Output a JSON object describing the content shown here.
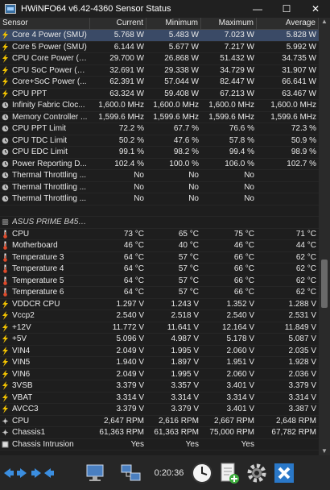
{
  "window": {
    "title": "HWiNFO64 v6.42-4360 Sensor Status",
    "minimize": "—",
    "maximize": "☐",
    "close": "✕"
  },
  "columns": [
    "Sensor",
    "Current",
    "Minimum",
    "Maximum",
    "Average"
  ],
  "rows": [
    {
      "icon": "bolt",
      "label": "Core 4 Power (SMU)",
      "cur": "5.768 W",
      "min": "5.483 W",
      "max": "7.023 W",
      "avg": "5.828 W",
      "selected": true
    },
    {
      "icon": "bolt",
      "label": "Core 5 Power (SMU)",
      "cur": "6.144 W",
      "min": "5.677 W",
      "max": "7.217 W",
      "avg": "5.992 W"
    },
    {
      "icon": "bolt",
      "label": "CPU Core Power (S...",
      "cur": "29.700 W",
      "min": "26.868 W",
      "max": "51.432 W",
      "avg": "34.735 W"
    },
    {
      "icon": "bolt",
      "label": "CPU SoC Power (S...",
      "cur": "32.691 W",
      "min": "29.338 W",
      "max": "34.729 W",
      "avg": "31.907 W"
    },
    {
      "icon": "bolt",
      "label": "Core+SoC Power (...",
      "cur": "62.391 W",
      "min": "57.044 W",
      "max": "82.447 W",
      "avg": "66.641 W"
    },
    {
      "icon": "bolt",
      "label": "CPU PPT",
      "cur": "63.324 W",
      "min": "59.408 W",
      "max": "67.213 W",
      "avg": "63.467 W"
    },
    {
      "icon": "clock",
      "label": "Infinity Fabric Cloc...",
      "cur": "1,600.0 MHz",
      "min": "1,600.0 MHz",
      "max": "1,600.0 MHz",
      "avg": "1,600.0 MHz"
    },
    {
      "icon": "clock",
      "label": "Memory Controller ...",
      "cur": "1,599.6 MHz",
      "min": "1,599.6 MHz",
      "max": "1,599.6 MHz",
      "avg": "1,599.6 MHz"
    },
    {
      "icon": "clock",
      "label": "CPU PPT Limit",
      "cur": "72.2 %",
      "min": "67.7 %",
      "max": "76.6 %",
      "avg": "72.3 %"
    },
    {
      "icon": "clock",
      "label": "CPU TDC Limit",
      "cur": "50.2 %",
      "min": "47.6 %",
      "max": "57.8 %",
      "avg": "50.9 %"
    },
    {
      "icon": "clock",
      "label": "CPU EDC Limit",
      "cur": "99.1 %",
      "min": "98.2 %",
      "max": "99.4 %",
      "avg": "98.9 %"
    },
    {
      "icon": "clock",
      "label": "Power Reporting D...",
      "cur": "102.4 %",
      "min": "100.0 %",
      "max": "106.0 %",
      "avg": "102.7 %"
    },
    {
      "icon": "clock",
      "label": "Thermal Throttling ...",
      "cur": "No",
      "min": "No",
      "max": "No",
      "avg": ""
    },
    {
      "icon": "clock",
      "label": "Thermal Throttling ...",
      "cur": "No",
      "min": "No",
      "max": "No",
      "avg": ""
    },
    {
      "icon": "clock",
      "label": "Thermal Throttling ...",
      "cur": "No",
      "min": "No",
      "max": "No",
      "avg": ""
    },
    {
      "icon": "none",
      "label": "",
      "cur": "",
      "min": "",
      "max": "",
      "avg": ""
    },
    {
      "icon": "chip",
      "label": "ASUS PRIME B450...",
      "cur": "",
      "min": "",
      "max": "",
      "avg": "",
      "group": true
    },
    {
      "icon": "thermo",
      "label": "CPU",
      "cur": "73 °C",
      "min": "65 °C",
      "max": "75 °C",
      "avg": "71 °C"
    },
    {
      "icon": "thermo",
      "label": "Motherboard",
      "cur": "46 °C",
      "min": "40 °C",
      "max": "46 °C",
      "avg": "44 °C"
    },
    {
      "icon": "thermo",
      "label": "Temperature 3",
      "cur": "64 °C",
      "min": "57 °C",
      "max": "66 °C",
      "avg": "62 °C"
    },
    {
      "icon": "thermo",
      "label": "Temperature 4",
      "cur": "64 °C",
      "min": "57 °C",
      "max": "66 °C",
      "avg": "62 °C"
    },
    {
      "icon": "thermo",
      "label": "Temperature 5",
      "cur": "64 °C",
      "min": "57 °C",
      "max": "66 °C",
      "avg": "62 °C"
    },
    {
      "icon": "thermo",
      "label": "Temperature 6",
      "cur": "64 °C",
      "min": "57 °C",
      "max": "66 °C",
      "avg": "62 °C"
    },
    {
      "icon": "bolt",
      "label": "VDDCR CPU",
      "cur": "1.297 V",
      "min": "1.243 V",
      "max": "1.352 V",
      "avg": "1.288 V"
    },
    {
      "icon": "bolt",
      "label": "Vccp2",
      "cur": "2.540 V",
      "min": "2.518 V",
      "max": "2.540 V",
      "avg": "2.531 V"
    },
    {
      "icon": "bolt",
      "label": "+12V",
      "cur": "11.772 V",
      "min": "11.641 V",
      "max": "12.164 V",
      "avg": "11.849 V"
    },
    {
      "icon": "bolt",
      "label": "+5V",
      "cur": "5.096 V",
      "min": "4.987 V",
      "max": "5.178 V",
      "avg": "5.087 V"
    },
    {
      "icon": "bolt",
      "label": "VIN4",
      "cur": "2.049 V",
      "min": "1.995 V",
      "max": "2.060 V",
      "avg": "2.035 V"
    },
    {
      "icon": "bolt",
      "label": "VIN5",
      "cur": "1.940 V",
      "min": "1.897 V",
      "max": "1.951 V",
      "avg": "1.928 V"
    },
    {
      "icon": "bolt",
      "label": "VIN6",
      "cur": "2.049 V",
      "min": "1.995 V",
      "max": "2.060 V",
      "avg": "2.036 V"
    },
    {
      "icon": "bolt",
      "label": "3VSB",
      "cur": "3.379 V",
      "min": "3.357 V",
      "max": "3.401 V",
      "avg": "3.379 V"
    },
    {
      "icon": "bolt",
      "label": "VBAT",
      "cur": "3.314 V",
      "min": "3.314 V",
      "max": "3.314 V",
      "avg": "3.314 V"
    },
    {
      "icon": "bolt",
      "label": "AVCC3",
      "cur": "3.379 V",
      "min": "3.379 V",
      "max": "3.401 V",
      "avg": "3.387 V"
    },
    {
      "icon": "fan",
      "label": "CPU",
      "cur": "2,647 RPM",
      "min": "2,616 RPM",
      "max": "2,667 RPM",
      "avg": "2,648 RPM"
    },
    {
      "icon": "fan",
      "label": "Chassis1",
      "cur": "61,363 RPM",
      "min": "61,363 RPM",
      "max": "75,000 RPM",
      "avg": "67,782 RPM"
    },
    {
      "icon": "box",
      "label": "Chassis Intrusion",
      "cur": "Yes",
      "min": "Yes",
      "max": "Yes",
      "avg": ""
    }
  ],
  "toolbar": {
    "elapsed": "0:20:36"
  }
}
